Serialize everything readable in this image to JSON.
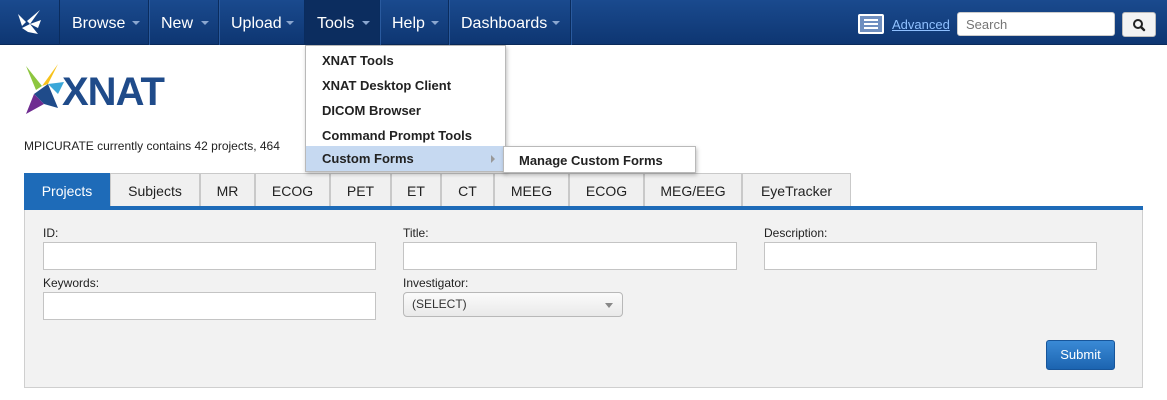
{
  "nav": {
    "items": [
      {
        "label": "Browse"
      },
      {
        "label": "New"
      },
      {
        "label": "Upload"
      },
      {
        "label": "Tools"
      },
      {
        "label": "Help"
      },
      {
        "label": "Dashboards"
      }
    ],
    "advanced_label": "Advanced",
    "search_placeholder": "Search"
  },
  "tools_menu": {
    "items": [
      "XNAT Tools",
      "XNAT Desktop Client",
      "DICOM Browser",
      "Command Prompt Tools",
      "Custom Forms"
    ],
    "submenu": [
      "Manage Custom Forms"
    ]
  },
  "brand": {
    "name": "XNAT"
  },
  "summary": "MPICURATE currently contains 42 projects, 464",
  "tabs": [
    "Projects",
    "Subjects",
    "MR",
    "ECOG",
    "PET",
    "ET",
    "CT",
    "MEEG",
    "ECOG",
    "MEG/EEG",
    "EyeTracker"
  ],
  "form": {
    "id_label": "ID:",
    "title_label": "Title:",
    "description_label": "Description:",
    "keywords_label": "Keywords:",
    "investigator_label": "Investigator:",
    "investigator_value": "(SELECT)",
    "submit_label": "Submit"
  },
  "colors": {
    "nav_bg": "#0e3672",
    "accent": "#1e6bb8",
    "menu_hover": "#c6d9f1"
  }
}
